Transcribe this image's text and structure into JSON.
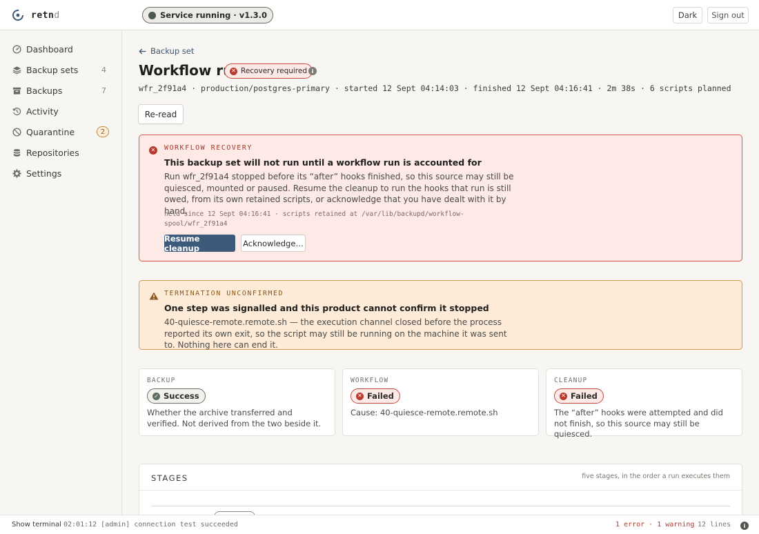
{
  "app": {
    "logo_main": "retn",
    "logo_tail": "d"
  },
  "header": {
    "service_status": "Service running · v1.3.0",
    "theme_button": "Dark",
    "signout_button": "Sign out"
  },
  "sidebar": {
    "items": [
      {
        "label": "Dashboard",
        "icon": "dashboard-icon"
      },
      {
        "label": "Backup sets",
        "icon": "layers-icon",
        "count": "4"
      },
      {
        "label": "Backups",
        "icon": "archive-icon",
        "count": "7"
      },
      {
        "label": "Activity",
        "icon": "history-icon"
      },
      {
        "label": "Quarantine",
        "icon": "prohibited-icon",
        "badge": "2"
      },
      {
        "label": "Repositories",
        "icon": "database-icon"
      },
      {
        "label": "Settings",
        "icon": "gear-icon"
      }
    ]
  },
  "main": {
    "back_link": "Backup set",
    "title": "Workflow run",
    "status_badge": "Recovery required",
    "meta": "wfr_2f91a4 · production/postgres-primary · started 12 Sept 04:14:03 · finished 12 Sept 04:16:41 · 2m 38s · 6 scripts planned",
    "reread_button": "Re-read"
  },
  "recovery_alert": {
    "kicker": "WORKFLOW RECOVERY",
    "heading": "This backup set will not run until a workflow run is accounted for",
    "body": "Run wfr_2f91a4 stopped before its “after” hooks finished, so this source may still be quiesced, mounted or paused. Resume the cleanup to run the hooks that run is still owed, from its own retained scripts, or acknowledge that you have dealt with it by hand.",
    "fine": "held since 12 Sept 04:16:41 · scripts retained at /var/lib/backupd/workflow-spool/wfr_2f91a4",
    "primary_button": "Resume cleanup",
    "secondary_button": "Acknowledge…"
  },
  "termination_alert": {
    "kicker": "TERMINATION UNCONFIRMED",
    "heading": "One step was signalled and this product cannot confirm it stopped",
    "body": "40-quiesce-remote.remote.sh — the execution channel closed before the process reported its own exit, so the script may still be running on the machine it was sent to. Nothing here can end it."
  },
  "stage_cards": [
    {
      "kicker": "BACKUP",
      "status": "Success",
      "kind": "ok",
      "desc": "Whether the archive transferred and verified. Not derived from the two beside it."
    },
    {
      "kicker": "WORKFLOW",
      "status": "Failed",
      "kind": "fail",
      "desc": "Cause: 40-quiesce-remote.remote.sh"
    },
    {
      "kicker": "CLEANUP",
      "status": "Failed",
      "kind": "fail",
      "desc": "The “after” hooks were attempted and did not finish, so this source may still be quiesced."
    }
  ],
  "stages": {
    "title": "STAGES",
    "note": "five stages, in the order a run executes them"
  },
  "footer": {
    "show_terminal": "Show terminal",
    "last_line": "02:01:12 [admin] connection test succeeded",
    "counts": "1 error · 1 warning",
    "lines": "12 lines"
  },
  "colors": {
    "accent": "#3e5a7a",
    "danger": "#b83a2e",
    "warning": "#d3954a",
    "background": "#f7f6f3"
  }
}
